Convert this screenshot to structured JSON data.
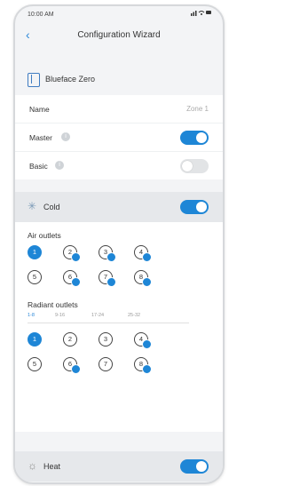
{
  "status": {
    "time": "10:00 AM",
    "icons": "signal-wifi-battery"
  },
  "nav": {
    "back": "‹",
    "title": "Configuration Wizard"
  },
  "device": {
    "label": "Blueface Zero"
  },
  "settings": {
    "name_label": "Name",
    "name_value": "Zone 1",
    "master_label": "Master",
    "master_on": true,
    "basic_label": "Basic",
    "basic_on": false
  },
  "cold": {
    "label": "Cold",
    "on": true,
    "air_outlets_label": "Air outlets",
    "air_outlets": [
      {
        "n": "1",
        "selected": true,
        "badge": false
      },
      {
        "n": "2",
        "selected": false,
        "badge": true
      },
      {
        "n": "3",
        "selected": false,
        "badge": true
      },
      {
        "n": "4",
        "selected": false,
        "badge": true
      },
      {
        "n": "5",
        "selected": false,
        "badge": false
      },
      {
        "n": "6",
        "selected": false,
        "badge": true
      },
      {
        "n": "7",
        "selected": false,
        "badge": true
      },
      {
        "n": "8",
        "selected": false,
        "badge": true
      }
    ],
    "radiant_label": "Radiant outlets",
    "radiant_tabs": [
      "1-8",
      "9-16",
      "17-24",
      "25-32"
    ],
    "radiant_active_tab": 0,
    "radiant_outlets": [
      {
        "n": "1",
        "selected": true,
        "badge": false
      },
      {
        "n": "2",
        "selected": false,
        "badge": false
      },
      {
        "n": "3",
        "selected": false,
        "badge": false
      },
      {
        "n": "4",
        "selected": false,
        "badge": true
      },
      {
        "n": "5",
        "selected": false,
        "badge": false
      },
      {
        "n": "6",
        "selected": false,
        "badge": true
      },
      {
        "n": "7",
        "selected": false,
        "badge": false
      },
      {
        "n": "8",
        "selected": false,
        "badge": true
      }
    ]
  },
  "heat": {
    "label": "Heat",
    "on": true
  },
  "colors": {
    "accent": "#1e86d6",
    "toggle_off": "#e2e4e6"
  }
}
